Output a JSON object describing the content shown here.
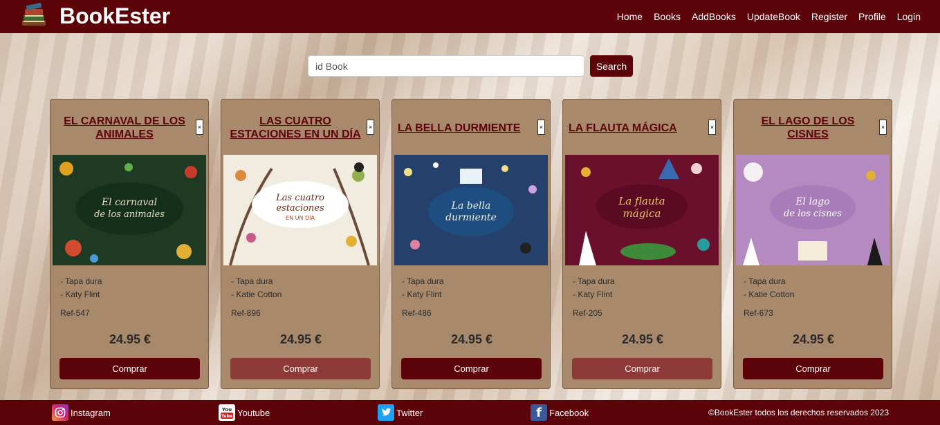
{
  "header": {
    "brand": "BookEster",
    "nav": [
      "Home",
      "Books",
      "AddBooks",
      "UpdateBook",
      "Register",
      "Profile",
      "Login"
    ]
  },
  "search": {
    "placeholder": "id Book",
    "button_label": "Search"
  },
  "books": [
    {
      "title": "EL CARNAVAL DE LOS ANIMALES",
      "cover_title": "El carnaval de los animales",
      "cover_color": "#1f3a22",
      "binding": "- Tapa dura",
      "author": "- Katy Flint",
      "ref": "Ref-547",
      "price": "24.95 €",
      "buy_label": "Comprar"
    },
    {
      "title": "LAS CUATRO ESTACIONES EN UN DÍA",
      "cover_title": "Las cuatro estaciones en un día",
      "cover_color": "#f1ebe0",
      "binding": "- Tapa dura",
      "author": "- Katie Cotton",
      "ref": "Ref-896",
      "price": "24.95 €",
      "buy_label": "Comprar"
    },
    {
      "title": "LA BELLA DURMIENTE",
      "cover_title": "La bella durmiente",
      "cover_color": "#25416b",
      "binding": "- Tapa dura",
      "author": "- Katy Flint",
      "ref": "Ref-486",
      "price": "24.95 €",
      "buy_label": "Comprar"
    },
    {
      "title": "LA FLAUTA MÁGICA",
      "cover_title": "La flauta mágica",
      "cover_color": "#6a0f2c",
      "binding": "- Tapa dura",
      "author": "- Katy Flint",
      "ref": "Ref-205",
      "price": "24.95 €",
      "buy_label": "Comprar"
    },
    {
      "title": "EL LAGO DE LOS CISNES",
      "cover_title": "El lago de los cisnes",
      "cover_color": "#b48ac0",
      "binding": "- Tapa dura",
      "author": "- Katie Cotton",
      "ref": "Ref-673",
      "price": "24.95 €",
      "buy_label": "Comprar"
    }
  ],
  "footer": {
    "instagram": "Instagram",
    "youtube": "Youtube",
    "twitter": "Twitter",
    "facebook": "Facebook",
    "copyright": "©BookEster todos los derechos reservados 2023"
  },
  "colors": {
    "primary": "#5c0309",
    "card": "#a8896c"
  }
}
